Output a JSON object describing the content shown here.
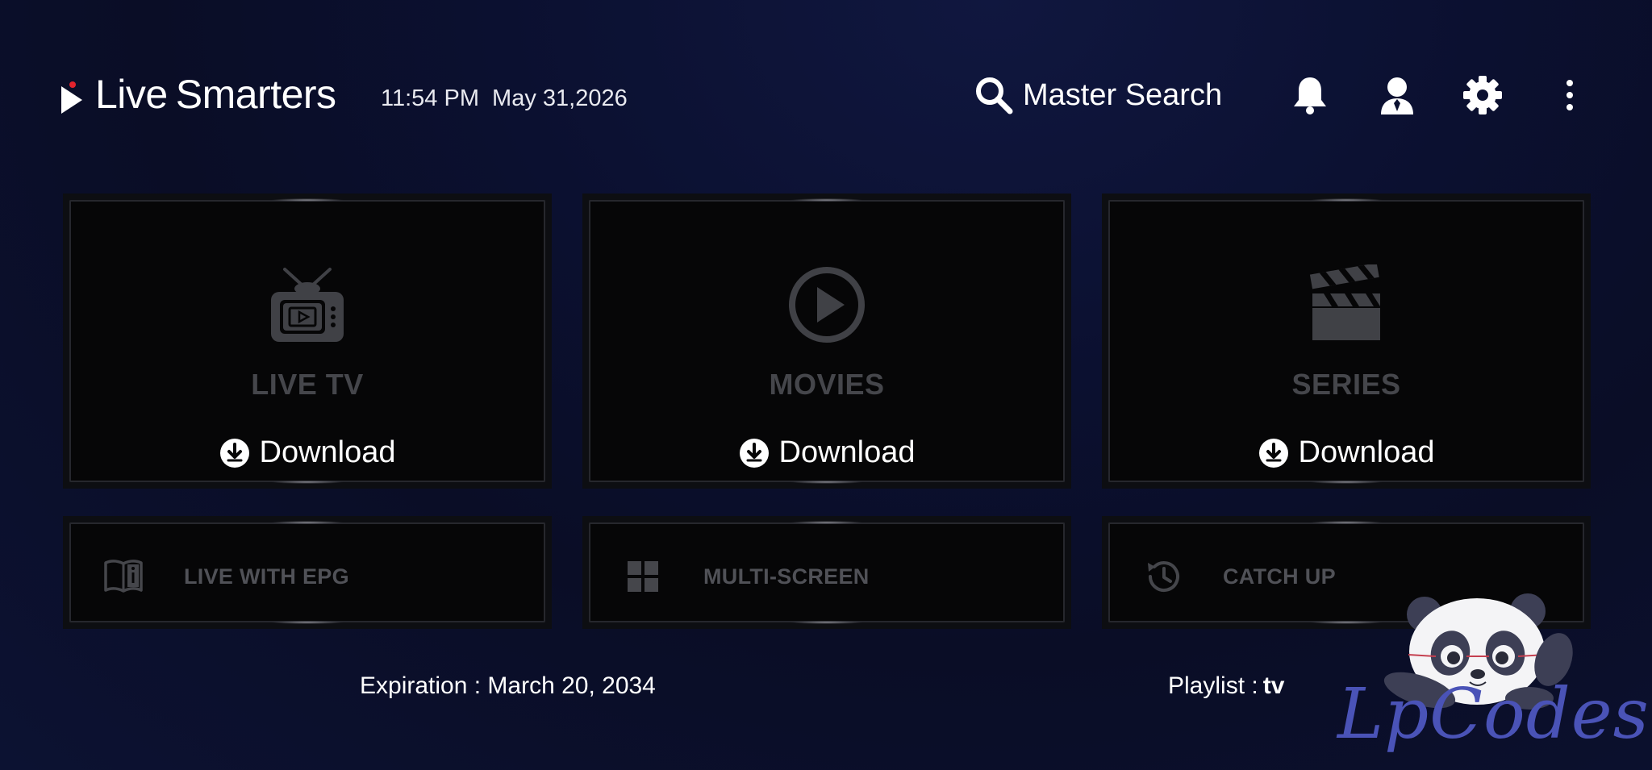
{
  "header": {
    "logo_word1": "Live",
    "logo_word2": "Smarters",
    "time": "11:54 PM",
    "date": "May 31,2026",
    "search_label": "Master Search"
  },
  "tiles": [
    {
      "title": "LIVE TV",
      "download_label": "Download",
      "icon": "tv-icon"
    },
    {
      "title": "MOVIES",
      "download_label": "Download",
      "icon": "play-circle-icon"
    },
    {
      "title": "SERIES",
      "download_label": "Download",
      "icon": "clapperboard-icon"
    }
  ],
  "small_tiles": [
    {
      "label": "LIVE WITH EPG",
      "icon": "book-info-icon"
    },
    {
      "label": "MULTI-SCREEN",
      "icon": "grid-icon"
    },
    {
      "label": "CATCH UP",
      "icon": "history-icon"
    }
  ],
  "footer": {
    "expiration": "Expiration : March 20, 2034",
    "playlist_label": "Playlist :",
    "playlist_value": "tv"
  },
  "watermark": {
    "text": "LpCodes"
  },
  "colors": {
    "background": "#0b1030",
    "tile": "#060607",
    "accent_red": "#e2232d",
    "muted_text": "#45464b",
    "watermark": "#4a53b7"
  }
}
